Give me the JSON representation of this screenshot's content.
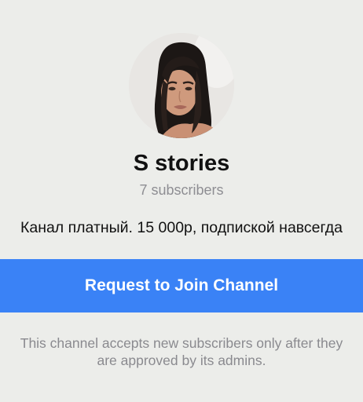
{
  "channel": {
    "name": "S stories",
    "subscribers": "7 subscribers",
    "description": "Канал платный. 15 000р, подпиской навсегда",
    "avatar_alt": "channel avatar photo"
  },
  "actions": {
    "join_label": "Request to Join Channel"
  },
  "notice": {
    "line1": "This channel accepts new subscribers only after they",
    "line2": "are approved by its admins."
  },
  "colors": {
    "background": "#ecedea",
    "accent": "#3a82f6",
    "secondary_text": "#8e8e93",
    "primary_text": "#111111"
  }
}
